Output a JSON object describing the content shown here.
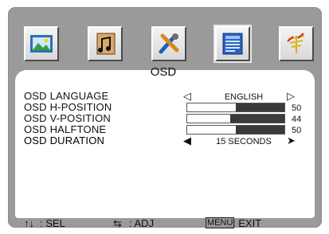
{
  "osd": {
    "title": "OSD",
    "tabs": [
      {
        "icon": "picture-icon",
        "selected": false
      },
      {
        "icon": "music-icon",
        "selected": false
      },
      {
        "icon": "tools-icon",
        "selected": false
      },
      {
        "icon": "osd-menu-icon",
        "selected": true
      },
      {
        "icon": "antenna-icon",
        "selected": false
      }
    ],
    "rows": [
      {
        "label": "OSD  LANGUAGE",
        "type": "option",
        "value": "ENGLISH"
      },
      {
        "label": "OSD  H-POSITION",
        "type": "slider",
        "value": "50",
        "level": 50
      },
      {
        "label": "OSD  V-POSITION",
        "type": "slider",
        "value": "44",
        "level": 44
      },
      {
        "label": "OSD  HALFTONE",
        "type": "slider",
        "value": "50",
        "level": 50
      },
      {
        "label": "OSD  DURATION",
        "type": "option",
        "value": "15 SECONDS"
      }
    ],
    "footer": {
      "sel_glyph": "↑↓",
      "sel_label": ": SEL",
      "adj_glyph": "⇆",
      "adj_label": ": ADJ",
      "menu_box": "MENU",
      "exit_label": ": EXIT"
    }
  }
}
